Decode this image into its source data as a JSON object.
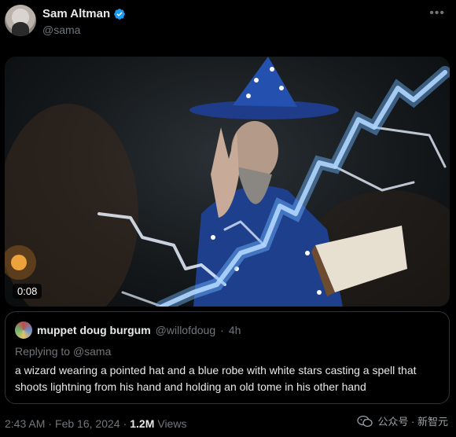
{
  "author": {
    "display_name": "Sam Altman",
    "handle": "@sama"
  },
  "more_label": "•••",
  "media": {
    "duration": "0:08"
  },
  "quote": {
    "display_name": "muppet doug burgum",
    "handle": "@willofdoug",
    "separator": "·",
    "time": "4h",
    "replying_prefix": "Replying to",
    "replying_to": "@sama",
    "text": "a wizard wearing a pointed hat and a blue robe with white stars casting a spell that shoots lightning from his hand and holding an old tome in his other hand"
  },
  "meta": {
    "time": "2:43 AM",
    "sep1": "·",
    "date": "Feb 16, 2024",
    "sep2": "·",
    "views_count": "1.2M",
    "views_label": "Views"
  },
  "watermark": {
    "text": "公众号 · 新智元"
  },
  "colors": {
    "verified": "#1d9bf0",
    "background": "#000000",
    "secondary_text": "#71767b"
  }
}
